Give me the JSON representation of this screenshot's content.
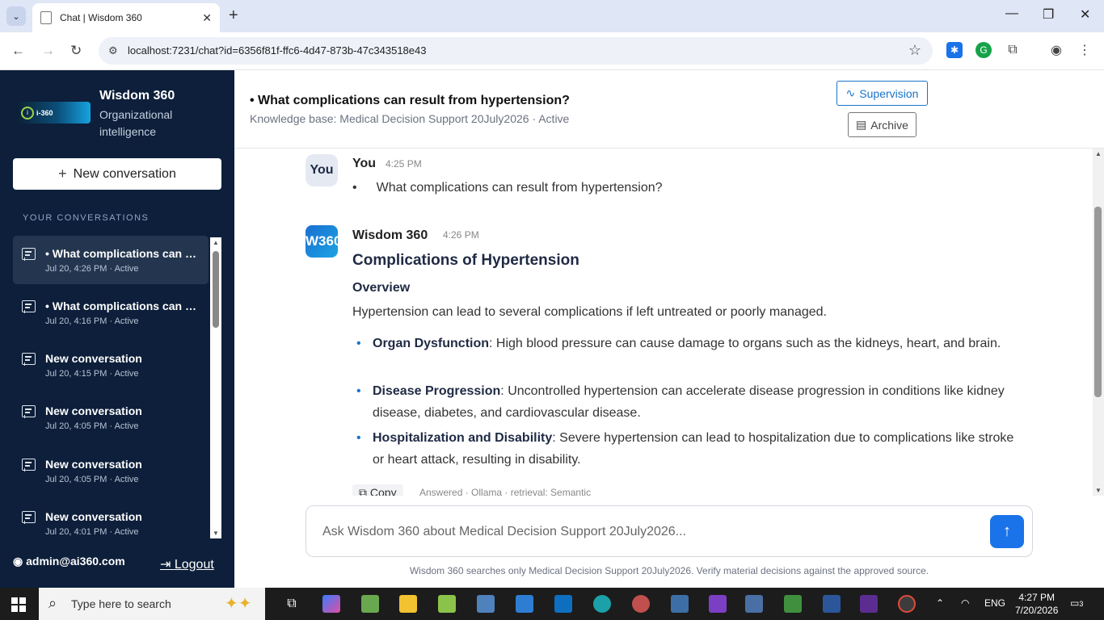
{
  "browser": {
    "tab_title": "Chat | Wisdom 360",
    "url": "localhost:7231/chat?id=6356f81f-ffc6-4d47-873b-47c343518e43"
  },
  "sidebar": {
    "brand_name": "Wisdom 360",
    "brand_subtitle": "Organizational intelligence",
    "logo_text": "i-360",
    "new_conversation": "New conversation",
    "section_label": "YOUR CONVERSATIONS",
    "conversations": [
      {
        "title": "• What complications can result from hypertension?",
        "meta": "Jul 20, 4:26 PM · Active"
      },
      {
        "title": "• What complications can result from hypertension?",
        "meta": "Jul 20, 4:16 PM · Active"
      },
      {
        "title": "New conversation",
        "meta": "Jul 20, 4:15 PM · Active"
      },
      {
        "title": "New conversation",
        "meta": "Jul 20, 4:05 PM · Active"
      },
      {
        "title": "New conversation",
        "meta": "Jul 20, 4:05 PM · Active"
      },
      {
        "title": "New conversation",
        "meta": "Jul 20, 4:01 PM · Active"
      }
    ],
    "user": "admin@ai360.com",
    "logout": "Logout"
  },
  "header": {
    "title": "• What complications can result from hypertension?",
    "subtitle": "Knowledge base: Medical Decision Support 20July2026 · Active",
    "supervision": "Supervision",
    "archive": "Archive"
  },
  "chat": {
    "user_avatar": "You",
    "user_name": "You",
    "user_time": "4:25 PM",
    "user_message": "What complications can result from hypertension?",
    "bot_avatar": "W360",
    "bot_name": "Wisdom 360",
    "bot_time": "4:26 PM",
    "heading": "Complications of Hypertension",
    "overview_heading": "Overview",
    "overview_text": "Hypertension can lead to several complications if left untreated or poorly managed.",
    "bullets": [
      {
        "term": "Organ Dysfunction",
        "text": ": High blood pressure can cause damage to organs such as the kidneys, heart, and brain."
      },
      {
        "term": "Disease Progression",
        "text": ": Uncontrolled hypertension can accelerate disease progression in conditions like kidney disease, diabetes, and cardiovascular disease."
      },
      {
        "term": "Hospitalization and Disability",
        "text": ": Severe hypertension can lead to hospitalization due to complications like stroke or heart attack, resulting in disability."
      }
    ],
    "copy": "Copy",
    "answer_meta": "Answered · Ollama · retrieval: Semantic"
  },
  "composer": {
    "placeholder": "Ask Wisdom 360 about Medical Decision Support 20July2026...",
    "footer": "Wisdom 360 searches only Medical Decision Support 20July2026. Verify material decisions against the approved source."
  },
  "taskbar": {
    "search_placeholder": "Type here to search",
    "language": "ENG",
    "time": "4:27 PM",
    "date": "7/20/2026",
    "notifications": "3"
  },
  "colors": {
    "sidebar_bg": "#0d1f3a",
    "accent": "#1a73e8"
  }
}
